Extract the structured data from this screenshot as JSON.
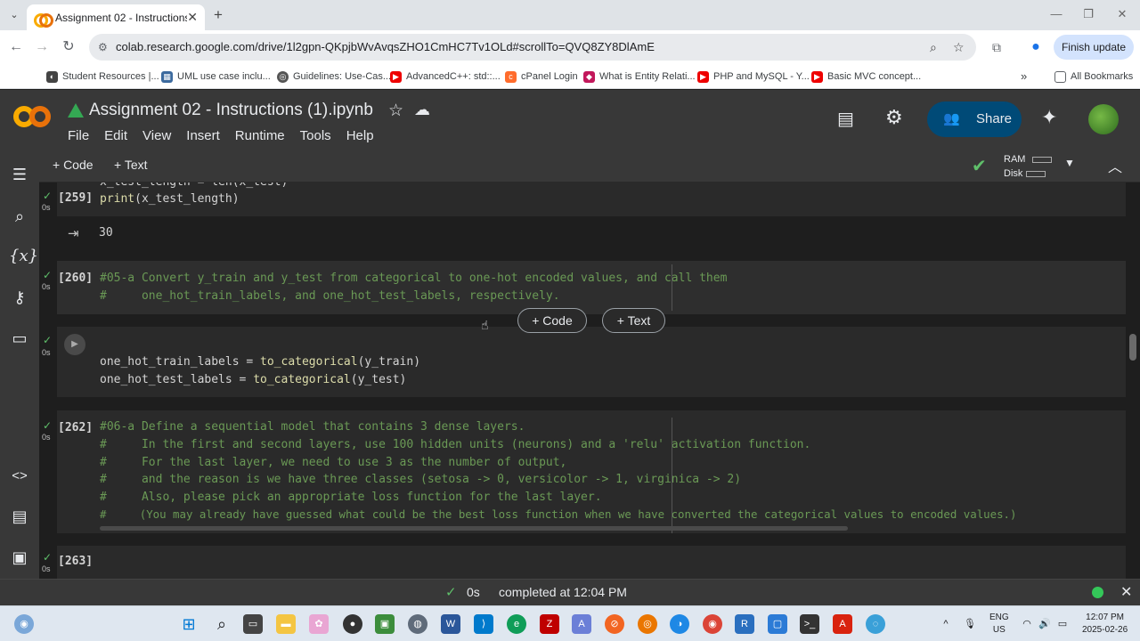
{
  "browser": {
    "tab_title": "Assignment 02 - Instructions (1)",
    "url": "colab.research.google.com/drive/1l2gpn-QKpjbWvAvqsZHO1CmHC7Tv1OLd#scrollTo=QVQ8ZY8DlAmE",
    "finish_update": "Finish update",
    "bookmarks": [
      "Student Resources |...",
      "UML use case inclu...",
      "Guidelines: Use-Cas...",
      "AdvancedC++: std::...",
      "cPanel Login",
      "What is Entity Relati...",
      "PHP and MySQL - Y...",
      "Basic MVC concept..."
    ],
    "all_bookmarks": "All Bookmarks"
  },
  "colab": {
    "title": "Assignment 02 - Instructions (1).ipynb",
    "menu": [
      "File",
      "Edit",
      "View",
      "Insert",
      "Runtime",
      "Tools",
      "Help"
    ],
    "share": "Share",
    "add_code": "+ Code",
    "add_text": "+ Text",
    "ram_label": "RAM",
    "disk_label": "Disk"
  },
  "cells": {
    "c259": {
      "partial_line": "x_test_length = len(x_test)",
      "exec": "[259]",
      "code": "print(x_test_length)",
      "time": "0s",
      "output": "30"
    },
    "c260": {
      "exec": "[260]",
      "time": "0s",
      "line1": "#05-a Convert y_train and y_test from categorical to one-hot encoded values, and call them",
      "line2": "#     one_hot_train_labels, and one_hot_test_labels, respectively."
    },
    "c261": {
      "time": "0s",
      "line1": "one_hot_train_labels = to_categorical(y_train)",
      "line2": "one_hot_test_labels = to_categorical(y_test)"
    },
    "c262": {
      "exec": "[262]",
      "time": "0s",
      "lines": [
        "#06-a Define a sequential model that contains 3 dense layers.",
        "#     In the first and second layers, use 100 hidden units (neurons) and a 'relu' activation function.",
        "#     For the last layer, we need to use 3 as the number of output,",
        "#     and the reason is we have three classes (setosa -> 0, versicolor -> 1, virginica -> 2)",
        "#     Also, please pick an appropriate loss function for the last layer.",
        "#     (You may already have guessed what could be the best loss function when we have converted the categorical values to encoded values.)"
      ]
    },
    "c263": {
      "exec": "[263]",
      "time": "0s"
    },
    "insert_code": "+ Code",
    "insert_text": "+ Text"
  },
  "status": {
    "time": "0s",
    "completed": "completed at 12:04 PM"
  },
  "taskbar": {
    "lang1": "ENG",
    "lang2": "US",
    "time": "12:07 PM",
    "date": "2025-02-26"
  },
  "colors": {
    "accent_blue": "#004a77",
    "success_green": "#5fbf6a",
    "comment_green": "#6a9955"
  }
}
